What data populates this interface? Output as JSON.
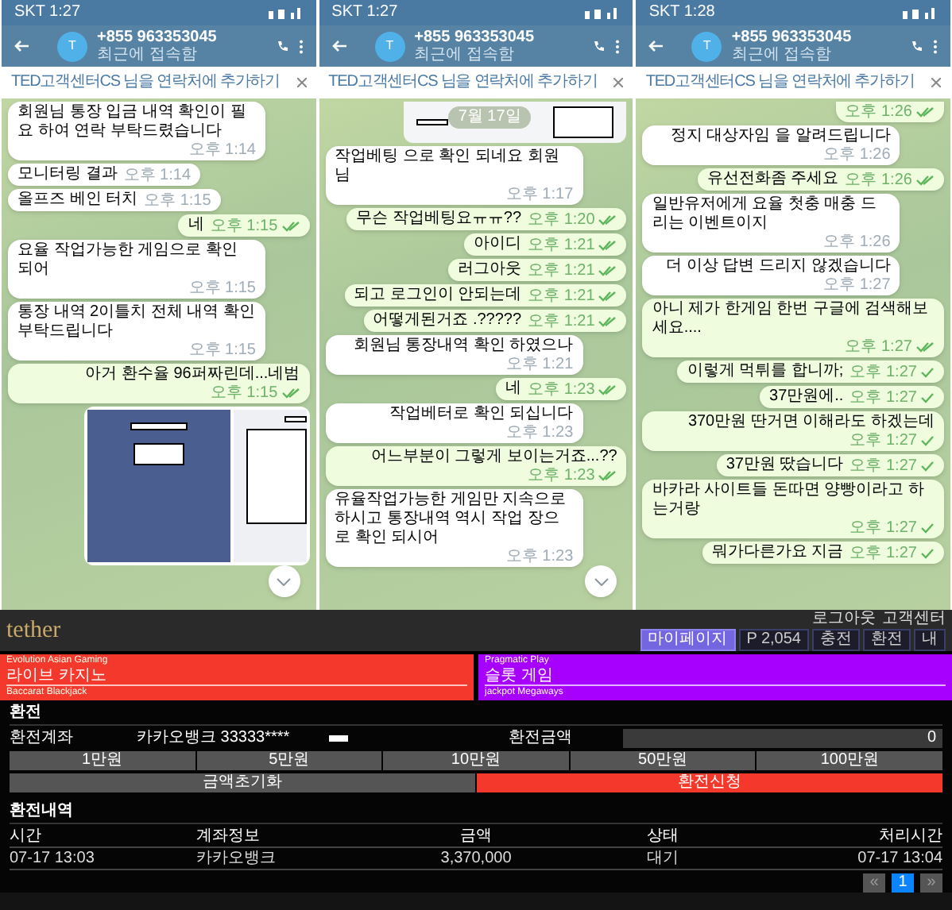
{
  "phones": [
    {
      "status_time": "SKT 1:27",
      "contact": {
        "avatar": "T",
        "name": "+855 963353045",
        "status": "최근에 접속함"
      },
      "banner": "TED고객센터CS 님을 연락처에 추가하기",
      "scroll_button": true,
      "messages": [
        {
          "kind": "text",
          "outgoing": false,
          "text": "회원님 통장 입금 내역 확인이 필요 하여 연락 부탁드렸습니다",
          "time": "오후 1:14"
        },
        {
          "kind": "text",
          "outgoing": false,
          "text": "모니터링 결과",
          "time": "오후 1:14"
        },
        {
          "kind": "text",
          "outgoing": false,
          "text": "올프즈 베인 터치",
          "time": "오후 1:15"
        },
        {
          "kind": "text",
          "outgoing": true,
          "text": "네",
          "time": "오후 1:15",
          "read": true
        },
        {
          "kind": "text",
          "outgoing": false,
          "text": "요율 작업가능한 게임으로 확인 되어",
          "time": "오후 1:15"
        },
        {
          "kind": "text",
          "outgoing": false,
          "text": "통장 내역 2이틀치 전체 내역 확인 부탁드립니다",
          "time": "오후 1:15"
        },
        {
          "kind": "text",
          "outgoing": true,
          "text": "아거 환수율 96퍼짜린데...네범",
          "time": "오후 1:15",
          "read": true
        },
        {
          "kind": "image",
          "outgoing": true
        }
      ]
    },
    {
      "status_time": "SKT 1:27",
      "contact": {
        "avatar": "T",
        "name": "+855 963353045",
        "status": "최근에 접속함"
      },
      "banner": "TED고객센터CS 님을 연락처에 추가하기",
      "scroll_button": true,
      "messages": [
        {
          "kind": "image_top",
          "outgoing": true,
          "date": "7월 17일"
        },
        {
          "kind": "text",
          "outgoing": false,
          "text": "작업베팅 으로 확인 되네요 회원님",
          "time": "오후 1:17"
        },
        {
          "kind": "text",
          "outgoing": true,
          "text": "무슨 작업베팅요ㅠㅠ??",
          "time": "오후 1:20",
          "read": true
        },
        {
          "kind": "text",
          "outgoing": true,
          "text": "아이디",
          "time": "오후 1:21",
          "read": true
        },
        {
          "kind": "text",
          "outgoing": true,
          "text": "러그아웃",
          "time": "오후 1:21",
          "read": true
        },
        {
          "kind": "text",
          "outgoing": true,
          "text": "되고 로그인이 안되는데",
          "time": "오후 1:21",
          "read": true
        },
        {
          "kind": "text",
          "outgoing": true,
          "text": "어떻게된거죠 .?????",
          "time": "오후 1:21",
          "read": true
        },
        {
          "kind": "text",
          "outgoing": false,
          "text": "회원님 통장내역 확인 하였으나",
          "time": "오후 1:21"
        },
        {
          "kind": "text",
          "outgoing": true,
          "text": "네",
          "time": "오후 1:23",
          "read": true
        },
        {
          "kind": "text",
          "outgoing": false,
          "text": "작업베터로 확인 되십니다",
          "time": "오후 1:23"
        },
        {
          "kind": "text",
          "outgoing": true,
          "text": "어느부분이 그렇게 보이는거죠...??",
          "time": "오후 1:23",
          "read": true
        },
        {
          "kind": "text",
          "outgoing": false,
          "text": "유율작업가능한 게임만 지속으로 하시고 통장내역 역시 작업 장으로 확인 되시어",
          "time": "오후 1:23"
        }
      ]
    },
    {
      "status_time": "SKT 1:28",
      "contact": {
        "avatar": "T",
        "name": "+855 963353045",
        "status": "최근에 접속함"
      },
      "banner": "TED고객센터CS 님을 연락처에 추가하기",
      "scroll_button": false,
      "messages": [
        {
          "kind": "cut",
          "outgoing": true,
          "time": "오후 1:26",
          "read": true
        },
        {
          "kind": "text",
          "outgoing": false,
          "text": "정지 대상자임 을 알려드립니다",
          "time": "오후 1:26"
        },
        {
          "kind": "text",
          "outgoing": true,
          "text": "유선전화좀 주세요",
          "time": "오후 1:26",
          "read": true
        },
        {
          "kind": "text",
          "outgoing": false,
          "text": "일반유저에게 요율 첫충 매충 드리는 이벤트이지",
          "time": "오후 1:26"
        },
        {
          "kind": "text",
          "outgoing": false,
          "text": "더 이상 답변 드리지 않겠습니다",
          "time": "오후 1:27"
        },
        {
          "kind": "text",
          "outgoing": true,
          "text": "아니 제가 한게임 한번 구글에 검색해보세요....",
          "time": "오후 1:27",
          "read": true
        },
        {
          "kind": "text",
          "outgoing": true,
          "text": "이렇게 먹튀를 합니까;",
          "time": "오후 1:27",
          "read": false
        },
        {
          "kind": "text",
          "outgoing": true,
          "text": "37만원에..",
          "time": "오후 1:27",
          "read": false
        },
        {
          "kind": "text",
          "outgoing": true,
          "text": "370만원 딴거면 이해라도 하겠는데",
          "time": "오후 1:27",
          "read": false
        },
        {
          "kind": "text",
          "outgoing": true,
          "text": "37만원 땄습니다",
          "time": "오후 1:27",
          "read": false
        },
        {
          "kind": "text",
          "outgoing": true,
          "text": "바카라 사이트들 돈따면 양빵이라고 하는거랑",
          "time": "오후 1:27",
          "read": false
        },
        {
          "kind": "text",
          "outgoing": true,
          "text": "뭐가다른가요 지금",
          "time": "오후 1:27",
          "read": false
        }
      ]
    }
  ],
  "site": {
    "logo": "tether",
    "top_links": [
      "로그아웃",
      "고객센터"
    ],
    "nav": [
      {
        "label": "마이페이지",
        "selected": true
      },
      {
        "label": "P 2,054",
        "selected": false
      },
      {
        "label": "충전",
        "selected": false
      },
      {
        "label": "환전",
        "selected": false
      },
      {
        "label": "내",
        "selected": false
      }
    ],
    "promos": [
      {
        "color": "#f4392c",
        "provider": "Evolution Asian Gaming",
        "title": "라이브 카지노",
        "subtitle": "Baccarat Blackjack"
      },
      {
        "color": "#a800ff",
        "provider": "Pragmatic Play",
        "title": "슬롯 게임",
        "subtitle": "jackpot Megaways"
      }
    ],
    "exchange": {
      "title": "환전",
      "account_label": "환전계좌",
      "account_value": "카카오뱅크 33333****",
      "amount_label": "환전금액",
      "amount_value": "0",
      "amount_buttons": [
        "1만원",
        "5만원",
        "10만원",
        "50만원",
        "100만원"
      ],
      "reset_button": "금액초기화",
      "submit_button": "환전신청"
    },
    "history": {
      "title": "환전내역",
      "columns": [
        "시간",
        "계좌정보",
        "금액",
        "상태",
        "처리시간"
      ],
      "rows": [
        [
          "07-17 13:03",
          "카카오뱅크",
          "3,370,000",
          "대기",
          "07-17 13:04"
        ]
      ],
      "pagination": [
        {
          "label": "«",
          "selected": false
        },
        {
          "label": "1",
          "selected": true
        },
        {
          "label": "»",
          "selected": false
        }
      ]
    }
  }
}
